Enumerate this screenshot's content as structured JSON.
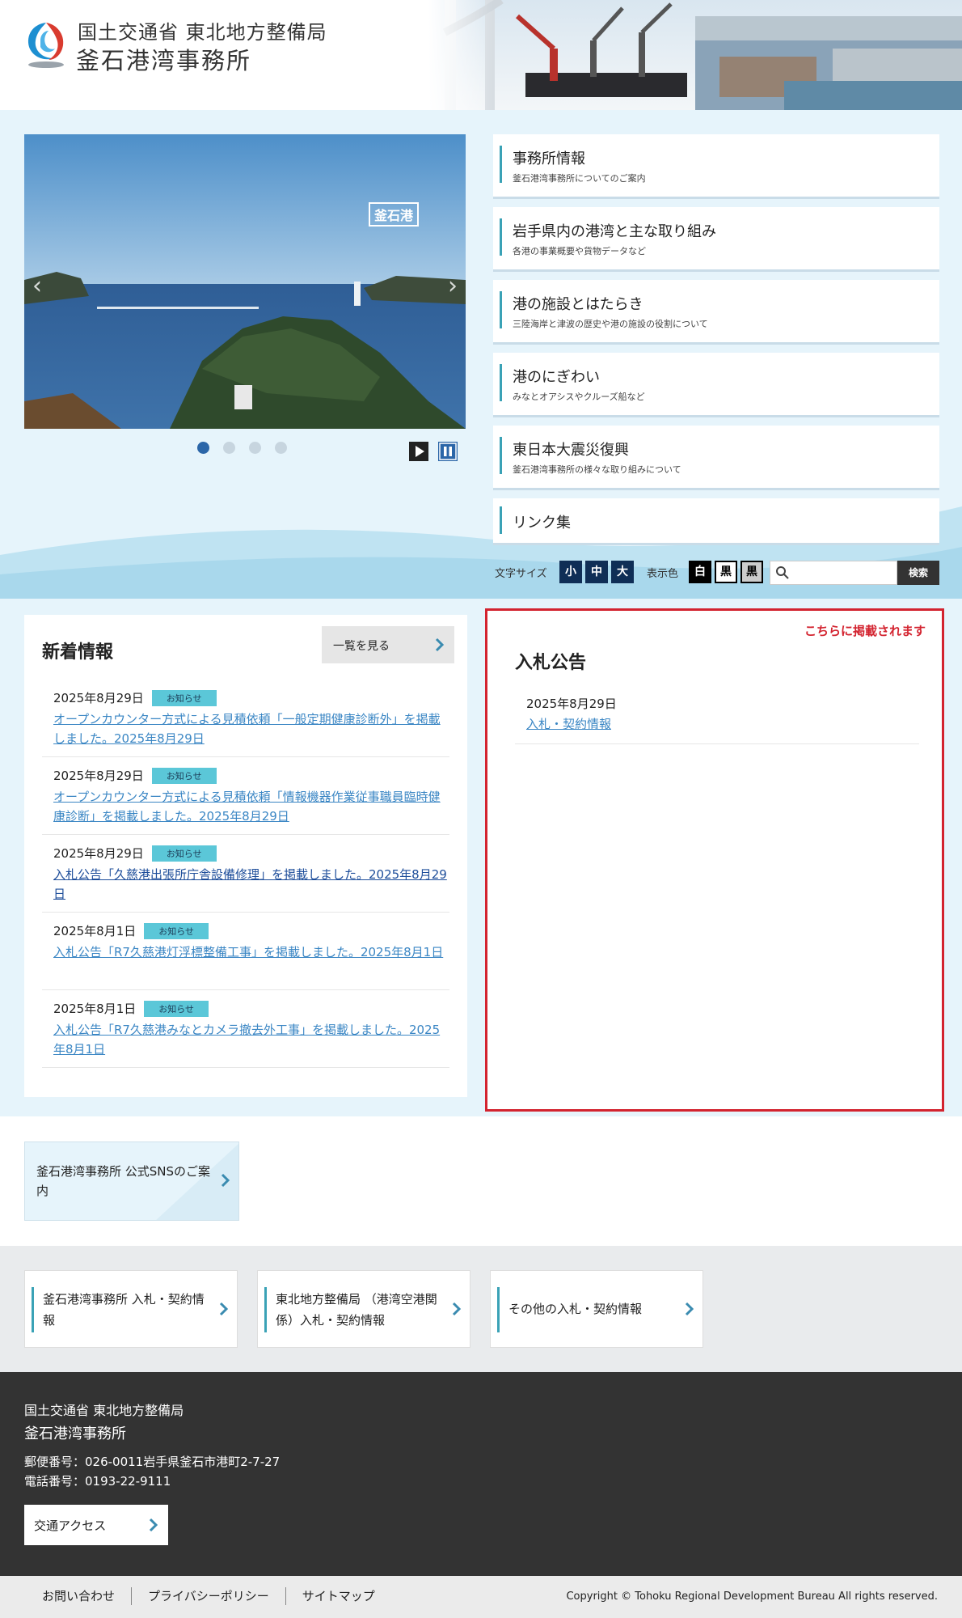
{
  "header": {
    "org_top": "国土交通省 東北地方整備局",
    "org_main": "釜石港湾事務所"
  },
  "slider": {
    "caption": "釜石港",
    "prev_glyph": "‹",
    "next_glyph": "›",
    "dot_count": 4,
    "active_dot": 1
  },
  "menu": {
    "items": [
      {
        "title": "事務所情報",
        "sub": "釜石港湾事務所についてのご案内"
      },
      {
        "title": "岩手県内の港湾と主な取り組み",
        "sub": "各港の事業概要や貨物データなど"
      },
      {
        "title": "港の施設とはたらき",
        "sub": "三陸海岸と津波の歴史や港の施設の役割について"
      },
      {
        "title": "港のにぎわい",
        "sub": "みなとオアシスやクルーズ船など"
      },
      {
        "title": "東日本大震災復興",
        "sub": "釜石港湾事務所の様々な取り組みについて"
      },
      {
        "title": "リンク集"
      }
    ]
  },
  "tools": {
    "font_size_label": "文字サイズ",
    "font_small": "小",
    "font_medium": "中",
    "font_large": "大",
    "color_label": "表示色",
    "color_white": "白",
    "color_black1": "黒",
    "color_black2": "黒",
    "search_placeholder": "",
    "search_button": "検索"
  },
  "news": {
    "title": "新着情報",
    "view_all": "一覧を見る",
    "items": [
      {
        "date": "2025年8月29日",
        "tag": "お知らせ",
        "text": "オープンカウンター方式による見積依頼「一般定期健康診断外」を掲載しました。2025年8月29日"
      },
      {
        "date": "2025年8月29日",
        "tag": "お知らせ",
        "text": "オープンカウンター方式による見積依頼「情報機器作業従事職員臨時健康診断」を掲載しました。2025年8月29日"
      },
      {
        "date": "2025年8月29日",
        "tag": "お知らせ",
        "text": "入札公告「久慈港出張所庁舎設備修理」を掲載しました。2025年8月29日"
      },
      {
        "date": "2025年8月1日",
        "tag": "お知らせ",
        "text": "入札公告「R7久慈港灯浮標整備工事」を掲載しました。2025年8月1日"
      },
      {
        "date": "2025年8月1日",
        "tag": "お知らせ",
        "text": "入札公告「R7久慈港みなとカメラ撤去外工事」を掲載しました。2025年8月1日"
      }
    ]
  },
  "bid": {
    "note": "こちらに掲載されます",
    "title": "入札公告",
    "date": "2025年8月29日",
    "link": "入札・契約情報"
  },
  "sns": {
    "label": "釜石港湾事務所 公式SNSのご案内"
  },
  "link_cards": [
    {
      "label": "釜石港湾事務所 入札・契約情報"
    },
    {
      "label": "東北地方整備局 （港湾空港関係）入札・契約情報"
    },
    {
      "label": "その他の入札・契約情報"
    }
  ],
  "footer": {
    "org1": "国土交通省 東北地方整備局",
    "org2": "釜石港湾事務所",
    "address": "郵便番号：026-0011岩手県釜石市港町2-7-27",
    "tel": "電話番号：0193-22-9111",
    "access": "交通アクセス",
    "links": [
      "お問い合わせ",
      "プライバシーポリシー",
      "サイトマップ"
    ],
    "copyright": "Copyright © Tohoku Regional Development Bureau All rights reserved."
  },
  "colors": {
    "accent": "#3aa2b6",
    "navy": "#0f2e56",
    "link": "#3a86c4",
    "tag": "#5bc7d8",
    "alert": "#d3232f",
    "bg_light": "#e6f4fb",
    "footer": "#333333"
  }
}
